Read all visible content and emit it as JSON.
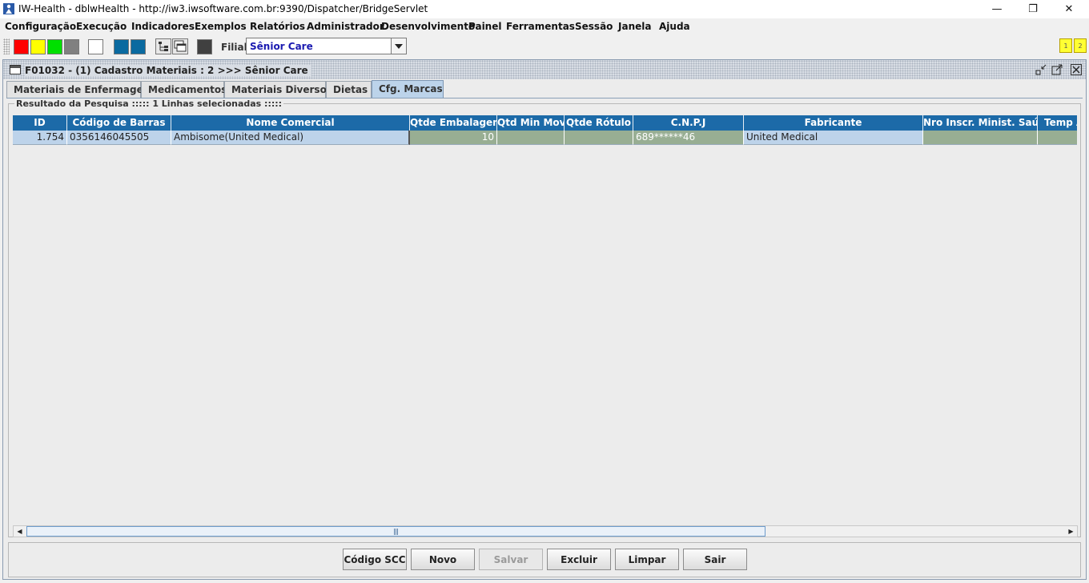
{
  "window": {
    "title": "IW-Health - dblwHealth - http://iw3.iwsoftware.com.br:9390/Dispatcher/BridgeServlet",
    "minimize": "—",
    "restore": "❐",
    "close": "✕"
  },
  "menu": [
    "Configuração",
    "Execução",
    "Indicadores",
    "Exemplos",
    "Relatórios",
    "Administrador",
    "Desenvolvimento",
    "Painel",
    "Ferramentas",
    "Sessão",
    "Janela",
    "Ajuda"
  ],
  "toolbar": {
    "swatch_colors": [
      "#ff0000",
      "#ffff00",
      "#00e000",
      "#808080",
      "#ffffff",
      "#0a6aa0",
      "#0a6aa0",
      "#404040"
    ],
    "filial_label": "Filial:",
    "filial_value": "Sênior Care",
    "tags": [
      "1",
      "2"
    ]
  },
  "frame": {
    "title": "F01032 - (1) Cadastro Materiais : 2 >>> Sênior Care",
    "tabs": [
      "Materiais de Enfermagem",
      "Medicamentos",
      "Materiais Diversos",
      "Dietas",
      "Cfg. Marcas"
    ],
    "active_tab": "Cfg. Marcas",
    "results_legend": "Resultado da Pesquisa ::::: 1 Linhas selecionadas :::::"
  },
  "table": {
    "columns": [
      "ID",
      "Código de Barras",
      "Nome Comercial",
      "Qtde Embalagem",
      "Qtd Min Mov",
      "Qtde Rótulo",
      "C.N.P.J",
      "Fabricante",
      "Nro Inscr. Minist. Saúde",
      "Temp A"
    ],
    "rows": [
      [
        "1.754",
        "0356146045505",
        "Ambisome(United Medical)",
        "10",
        "",
        "",
        "689******46",
        "United Medical",
        "",
        ""
      ]
    ]
  },
  "scrollbar": {
    "left": "◀",
    "right": "▶",
    "grip": "|||"
  },
  "buttons": {
    "codigo_scc": "Código SCC",
    "novo": "Novo",
    "salvar": "Salvar",
    "excluir": "Excluir",
    "limpar": "Limpar",
    "sair": "Sair"
  }
}
